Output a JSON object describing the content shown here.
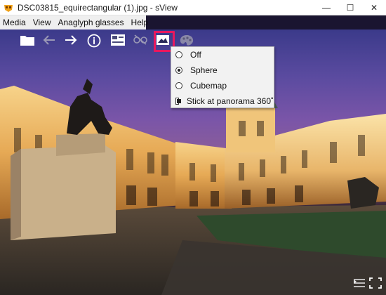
{
  "window": {
    "title": "DSC03815_equirectangular (1).jpg - sView",
    "minimize_glyph": "—",
    "maximize_glyph": "☐",
    "close_glyph": "✕"
  },
  "menu": {
    "items": [
      "Media",
      "View",
      "Anaglyph glasses",
      "Help"
    ]
  },
  "toolbar": {
    "icons": [
      "folder-icon",
      "back-arrow-icon",
      "forward-arrow-icon",
      "info-icon",
      "image-adjust-icon",
      "stereo-glasses-icon",
      "panorama-icon",
      "palette-icon"
    ],
    "active": "panorama-icon",
    "highlight_color": "#e8185e"
  },
  "panorama_menu": {
    "items": [
      {
        "label": "Off",
        "kind": "radio",
        "checked": false
      },
      {
        "label": "Sphere",
        "kind": "radio",
        "checked": true
      },
      {
        "label": "Cubemap",
        "kind": "radio",
        "checked": false
      },
      {
        "label": "Stick at panorama 360˚",
        "kind": "checkbox",
        "checked": true
      }
    ]
  },
  "corner": {
    "icons": [
      "playlist-icon",
      "fullscreen-icon"
    ]
  }
}
